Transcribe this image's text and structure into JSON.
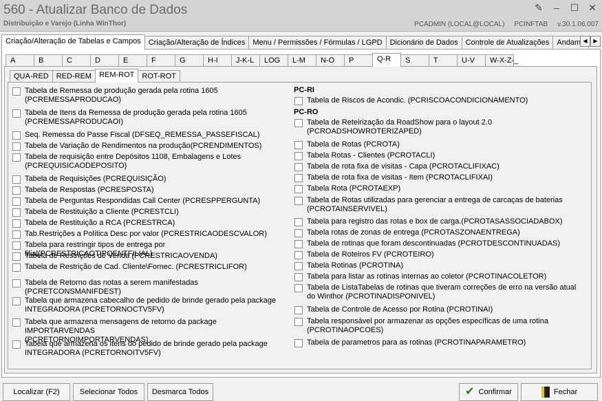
{
  "window": {
    "title": "560 - Atualizar Banco de Dados",
    "subtitle": "Distribuição e Varejo (Linha WinThor)",
    "user": "PCADMIN (LOCAL@LOCAL)",
    "program": "PCINFTAB",
    "version": "v.30.1.06.007",
    "buttons": [
      "✎",
      "–",
      "☐",
      "✕"
    ]
  },
  "main_tabs": [
    {
      "label": "Criação/Alteração de Tabelas e Campos",
      "active": true
    },
    {
      "label": "Criação/Alteração de Índices",
      "active": false
    },
    {
      "label": "Menu / Permissões / Fórmulas / LGPD",
      "active": false
    },
    {
      "label": "Dicionário de Dados",
      "active": false
    },
    {
      "label": "Controle de Atualizações",
      "active": false
    },
    {
      "label": "Andame",
      "active": false
    }
  ],
  "tab_scroll": [
    "◀",
    "▶"
  ],
  "letter_tabs": [
    {
      "label": "A",
      "active": false
    },
    {
      "label": "B",
      "active": false
    },
    {
      "label": "C",
      "active": false
    },
    {
      "label": "D",
      "active": false
    },
    {
      "label": "E",
      "active": false
    },
    {
      "label": "F",
      "active": false
    },
    {
      "label": "G",
      "active": false
    },
    {
      "label": "H-I",
      "active": false
    },
    {
      "label": "J-K-L",
      "active": false
    },
    {
      "label": "LOG",
      "active": false
    },
    {
      "label": "L-M",
      "active": false
    },
    {
      "label": "N-O",
      "active": false
    },
    {
      "label": "P",
      "active": false
    },
    {
      "label": "Q-R",
      "active": true
    },
    {
      "label": "S",
      "active": false
    },
    {
      "label": "T",
      "active": false
    },
    {
      "label": "U-V",
      "active": false
    },
    {
      "label": "W-X-Z-_",
      "active": false
    }
  ],
  "sub_tabs": [
    {
      "label": "QUA-RED",
      "active": false
    },
    {
      "label": "RED-REM",
      "active": false
    },
    {
      "label": "REM-ROT",
      "active": true
    },
    {
      "label": "ROT-ROT",
      "active": false
    }
  ],
  "left_column": [
    "Tabela de Remessa de produção gerada pela rotina 1605\n(PCREMESSAPRODUCAO)",
    "Tabela de Itens da Remessa de produção gerada pela rotina 1605\n(PCREMESSAPRODUCAOI)",
    "Seq. Remessa do Passe Fiscal (DFSEQ_REMESSA_PASSEFISCAL)",
    "Tabela de Variação de Rendimentos na produção(PCRENDIMENTOS)",
    "Tabela de requisição entre Depósitos 1108, Embalagens e Lotes\n(PCREQUISICAODEPOSITO)",
    "Tabela de Requisições (PCREQUISIÇÃO)",
    "Tabela de Respostas (PCRESPOSTA)",
    "Tabela de Perguntas Respondidas Call Center (PCRESPPERGUNTA)",
    "Tabela de Restituição a Cliente (PCRESTCLI)",
    "Tabela de Restituição a RCA (PCRESTRCA)",
    "Tab.Restrições a Política Desc por valor (PCRESTRICAODESCVALOR)",
    "Tabela para restringir tipos de entrega por filial(PCRESTRICAOTIPOENTFILIAL)",
    "Tabela de Restrições de Venda (PCRESTRICAOVENDA)",
    "Tabela de Restrição de Cad. Cliente\\Fornec. (PCRESTRICLIFOR)",
    "Tabela de Retorno das notas a serem manifestadas (PCRETCONSMANIFDEST)",
    "Tabela que armazena cabecalho de pedido de brinde gerado pela package\nINTEGRADORA (PCRETORNOCTV5FV)",
    "Tabela que armazena mensagens de retorno da  package IMPORTARVENDAS\n(PCRETORNOIMPORTARVENDAS)",
    "Tabela que armazena os itens do pedido de brinde gerado pela package\nINTEGRADORA (PCRETORNOITV5FV)"
  ],
  "right_sections": {
    "pcri": "PC-RI",
    "pcro": "PC-RO"
  },
  "right_column": [
    "Tabela de Riscos de Acondic. (PCRISCOACONDICIONAMENTO)",
    "Tabela de Reteirização da RoadShow para o layout 2.0\n(PCROADSHOWROTERIZAPED)",
    "Tabela de Rotas (PCROTA)",
    "Tabela Rotas - Clientes  (PCROTACLI)",
    "Tabela de rota fixa de visitas - Capa (PCROTACLIFIXAC)",
    "Tabela de rota fixa de visitas - Item (PCROTACLIFIXAI)",
    "Tabela Rota (PCROTAEXP)",
    "Tabela de Rotas utilizadas para gerenciar a entrega de carcaças de baterias\n(PCROTAINSERVIVEL)",
    "Tabela para registro das rotas e box de carga.(PCROTASASSOCIADABOX)",
    "Tabela rotas de zonas de entrega (PCROTASZONAENTREGA)",
    "Tabela de rotinas que foram descontinuadas (PCROTDESCONTINUADAS)",
    "Tabela de Roteiros FV (PCROTEIRO)",
    "Tabela Rotinas (PCROTINA)",
    "Tabela para listar as rotinas internas ao coletor (PCROTINACOLETOR)",
    "Tabela de ListaTabelas de rotinas que tiveram correções de erro na versão atual\ndo Winthor (PCROTINADISPONIVEL)",
    "Tabela de Controle de Acesso por Rotina (PCROTINAI)",
    "Tabela responsável por armazenar as opções específicas de uma rotina\n(PCROTINAOPCOES)",
    "Tabela de parametros para as rotinas (PCROTINAPARAMETRO)"
  ],
  "buttons": {
    "localizar": "Localizar (F2)",
    "selecionar": "Selecionar Todos",
    "desmarca": "Desmarca Todos",
    "confirmar": "Confirmar",
    "fechar": "Fechar"
  }
}
